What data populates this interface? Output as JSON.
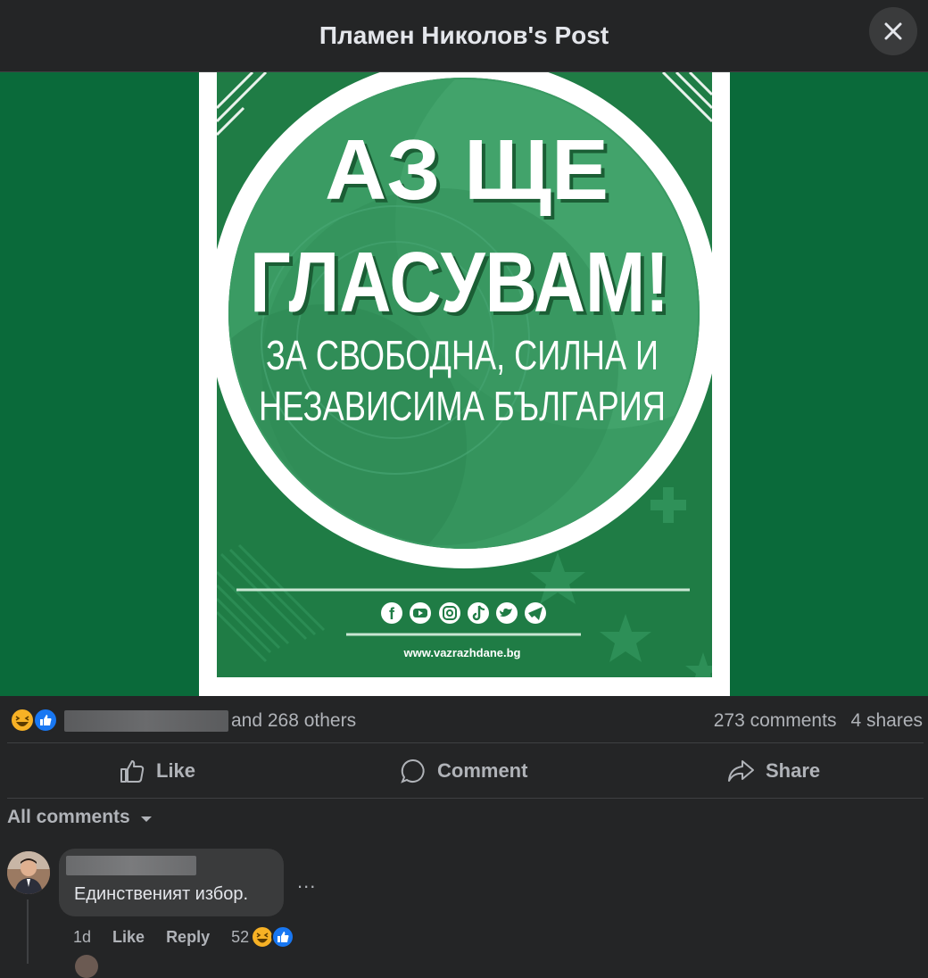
{
  "header": {
    "title": "Пламен Николов's Post"
  },
  "icons": {
    "close": "close-icon",
    "like": "thumbs-up-icon",
    "comment": "comment-bubble-icon",
    "share": "share-arrow-icon",
    "haha": "haha-reaction-icon",
    "like_reaction": "like-reaction-icon",
    "caret": "caret-down-icon"
  },
  "poster": {
    "line1": "АЗ ЩЕ",
    "line2": "ГЛАСУВАМ!",
    "line3": "ЗА СВОБОДНА, СИЛНА И",
    "line4": "НЕЗАВИСИМА БЪЛГАРИЯ",
    "website": "www.vazrazhdane.bg",
    "social_icons": [
      "facebook-icon",
      "youtube-icon",
      "instagram-icon",
      "tiktok-icon",
      "twitter-icon",
      "telegram-icon"
    ]
  },
  "stats": {
    "reactions_text": "and 268 others",
    "comments": "273 comments",
    "shares": "4 shares"
  },
  "actions": {
    "like": "Like",
    "comment": "Comment",
    "share": "Share"
  },
  "filter": {
    "label": "All comments"
  },
  "comment": {
    "text": "Единственият избор.",
    "time": "1d",
    "like": "Like",
    "reply": "Reply",
    "reaction_count": "52",
    "more": "..."
  },
  "colors": {
    "background": "#242526",
    "poster_green": "#1f7c45",
    "page_green": "#0a6a3a",
    "like_blue": "#1877f2",
    "haha_yellow": "#f7b125"
  }
}
